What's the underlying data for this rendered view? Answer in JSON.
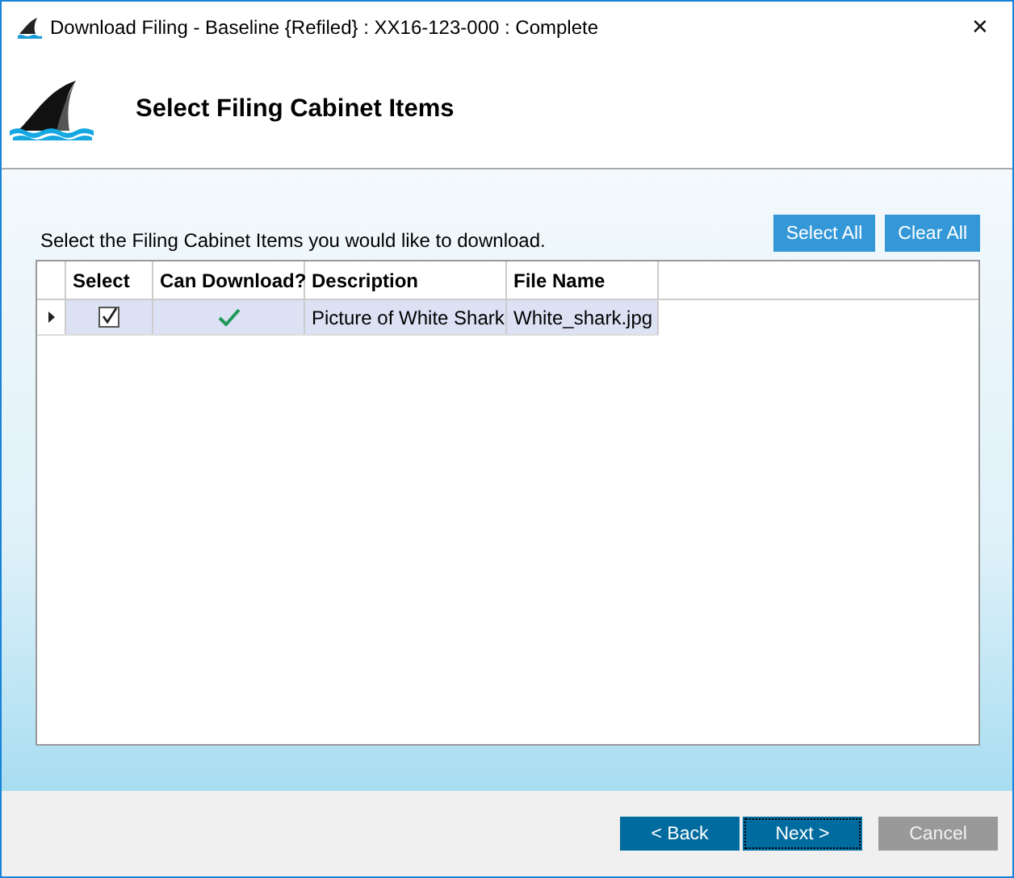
{
  "window": {
    "title": "Download Filing - Baseline {Refiled} : XX16-123-000 : Complete",
    "close": "✕"
  },
  "header": {
    "title": "Select Filing Cabinet Items"
  },
  "instruction": "Select the Filing Cabinet Items you would like to download.",
  "actions": [
    "Select All",
    "Clear All"
  ],
  "table": {
    "columns": [
      "Select",
      "Can Download?",
      "Description",
      "File Name"
    ],
    "rows": [
      {
        "selected": true,
        "current": true,
        "checked": true,
        "can_download": true,
        "description": "Picture of White Shark",
        "file_name": "White_shark.jpg"
      }
    ]
  },
  "buttons": [
    {
      "label": "< Back",
      "disabled": false,
      "focused": false
    },
    {
      "label": "Next >",
      "disabled": false,
      "focused": true
    },
    {
      "label": "Cancel",
      "disabled": true,
      "focused": false
    }
  ]
}
